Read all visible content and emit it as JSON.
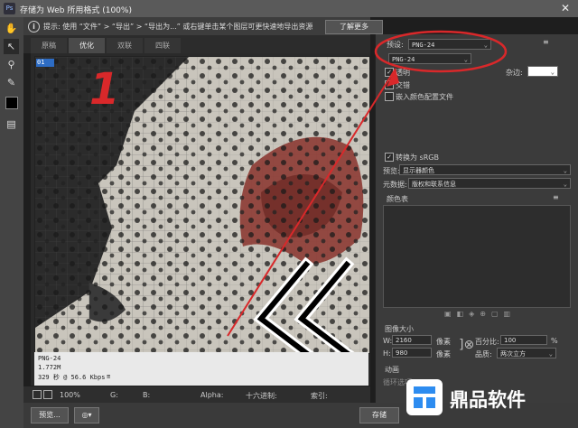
{
  "window": {
    "title": "存储为 Web 所用格式 (100%)",
    "close": "✕",
    "app_badge": "Ps"
  },
  "toolbar": {
    "tools": [
      "hand-tool",
      "slice-select-tool",
      "zoom-tool",
      "eyedropper-tool",
      "color-swatch",
      "toggle-slices"
    ]
  },
  "infobar": {
    "message": "提示: 使用 “文件” > “导出” > “导出为...” 或右键单击某个图层可更快速地导出资源",
    "learn_more": "了解更多"
  },
  "tabs": [
    {
      "label": "原稿",
      "active": false
    },
    {
      "label": "优化",
      "active": true
    },
    {
      "label": "双联",
      "active": false
    },
    {
      "label": "四联",
      "active": false
    }
  ],
  "preview": {
    "slice_badge": "01",
    "annotation_number": "1",
    "info": [
      "PNG-24",
      "1.772M",
      "329 秒 @ 56.6 Kbps"
    ],
    "info_menu": "≡"
  },
  "status": {
    "zoom": "100%",
    "g": "G:",
    "b": "B:",
    "alpha": "Alpha:",
    "hex": "十六进制:",
    "index": "索引:"
  },
  "bottom": {
    "preview_button": "预览...",
    "save_button": "存储"
  },
  "panel": {
    "preset_label": "预设:",
    "preset_value": "PNG-24",
    "format_value": "PNG-24",
    "transparency_label": "透明",
    "matte_label": "杂边:",
    "interlace_label": "交错",
    "embed_profile_label": "嵌入颜色配置文件",
    "convert_srgb_label": "转换为 sRGB",
    "preview_label": "预览:",
    "preview_value": "显示器颜色",
    "metadata_label": "元数据:",
    "metadata_value": "版权和联系信息",
    "color_table_label": "颜色表",
    "image_size_label": "图像大小",
    "w_label": "W:",
    "w_value": "2160",
    "h_label": "H:",
    "h_value": "980",
    "px_label": "像素",
    "percent_label": "百分比:",
    "percent_value": "100",
    "percent_unit": "%",
    "quality_label": "品质:",
    "quality_value": "两次立方",
    "animation_label": "动画",
    "loop_label": "循环选项:"
  },
  "watermark": {
    "text": "鼎品软件"
  },
  "colors": {
    "annotation_red": "#d9282a",
    "accent_blue": "#2d8cf0"
  }
}
